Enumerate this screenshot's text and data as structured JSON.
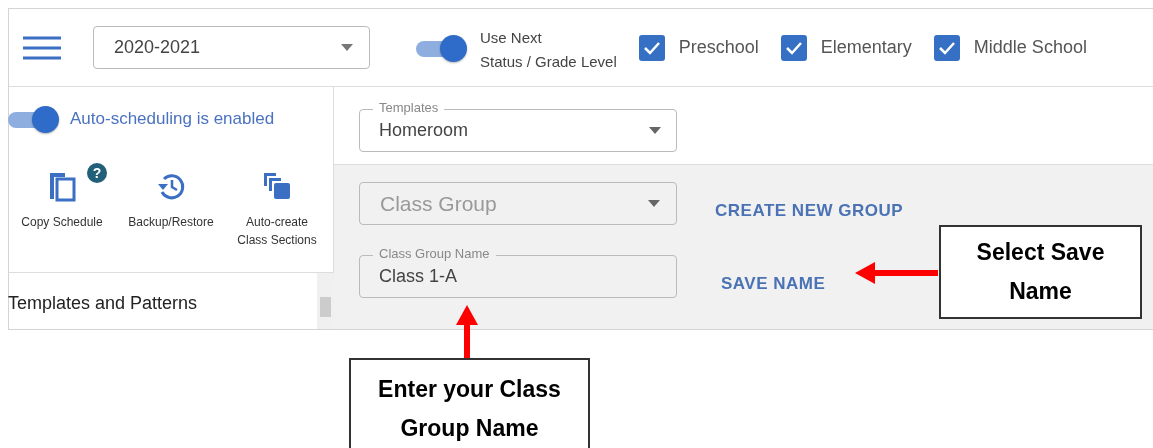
{
  "header": {
    "year_select": {
      "value": "2020-2021"
    },
    "next_status_toggle": {
      "on": true,
      "label_lines": [
        "Use Next",
        "Status / Grade Level"
      ]
    },
    "levels": [
      {
        "label": "Preschool",
        "checked": true
      },
      {
        "label": "Elementary",
        "checked": true
      },
      {
        "label": "Middle School",
        "checked": true
      }
    ]
  },
  "sidebar": {
    "auto_scheduling": {
      "on": true,
      "label": "Auto-scheduling is enabled"
    },
    "actions": [
      {
        "kind": "copy",
        "label": "Copy Schedule",
        "badge": "?"
      },
      {
        "kind": "restore",
        "label": "Backup/Restore"
      },
      {
        "kind": "autocreate",
        "label": "Auto-create Class Sections"
      }
    ],
    "section_title": "Templates and Patterns"
  },
  "templates": {
    "label": "Templates",
    "value": "Homeroom"
  },
  "group": {
    "select_placeholder": "Class Group",
    "create_button": "CREATE NEW GROUP",
    "name_field": {
      "label": "Class Group Name",
      "value": "Class 1-A"
    },
    "save_button": "SAVE NAME"
  },
  "callouts": [
    {
      "kind": "left",
      "text": "Select Save Name"
    },
    {
      "kind": "up",
      "text": "Enter your Class Group Name"
    }
  ]
}
